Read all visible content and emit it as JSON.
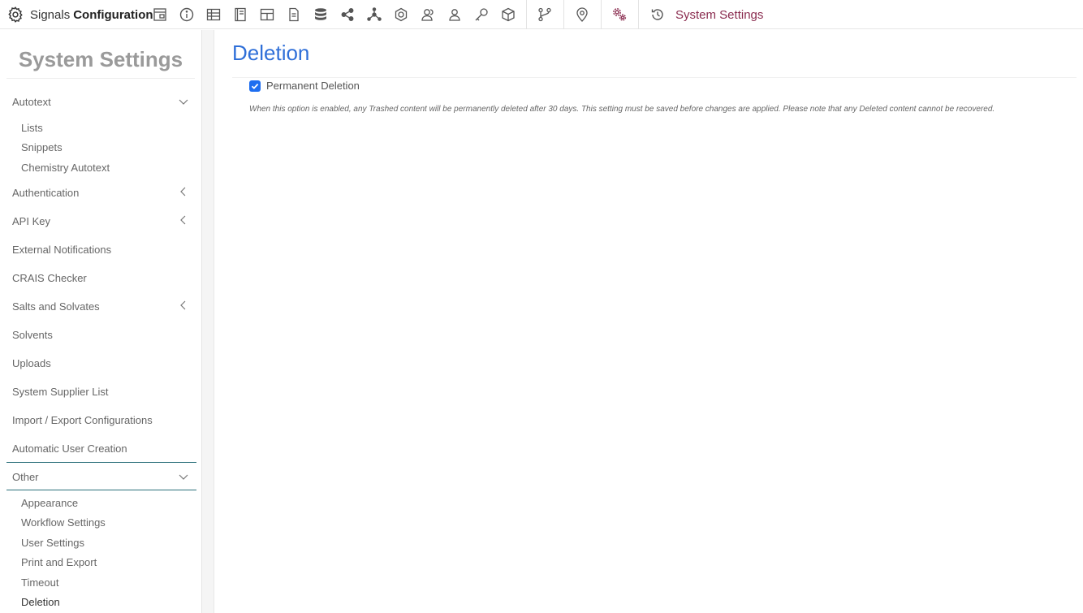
{
  "topbar": {
    "brand_light": "Signals",
    "brand_bold": "Configuration",
    "section_title": "System Settings"
  },
  "sidebar": {
    "title": "System Settings",
    "autotext": {
      "label": "Autotext",
      "items": [
        "Lists",
        "Snippets",
        "Chemistry Autotext"
      ]
    },
    "authentication": "Authentication",
    "api_key": "API Key",
    "external_notifications": "External Notifications",
    "crais_checker": "CRAIS Checker",
    "salts_and_solvates": "Salts and Solvates",
    "solvents": "Solvents",
    "uploads": "Uploads",
    "system_supplier_list": "System Supplier List",
    "import_export": "Import / Export Configurations",
    "automatic_user_creation": "Automatic User Creation",
    "other": {
      "label": "Other",
      "items": [
        "Appearance",
        "Workflow Settings",
        "User Settings",
        "Print and Export",
        "Timeout",
        "Deletion"
      ]
    }
  },
  "main": {
    "title": "Deletion",
    "permanent_deletion_label": "Permanent Deletion",
    "permanent_deletion_checked": true,
    "hint": "When this option is enabled, any Trashed content will be permanently deleted after 30 days. This setting must be saved before changes are applied. Please note that any Deleted content cannot be recovered."
  },
  "colors": {
    "accent_blue": "#2f6fd8",
    "brand_maroon": "#8a2c4f",
    "checkbox_blue": "#1e6ef0",
    "active_line": "#2a6f7a"
  }
}
